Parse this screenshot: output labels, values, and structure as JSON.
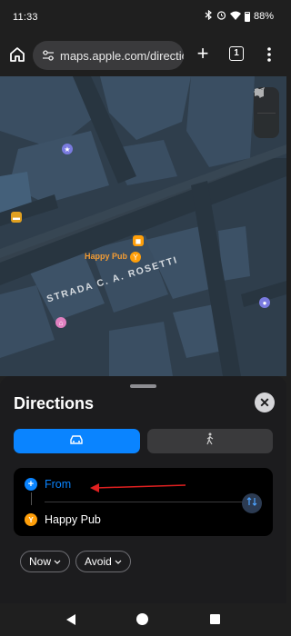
{
  "status_bar": {
    "time": "11:33",
    "battery": "88%",
    "icons": [
      "bluetooth-icon",
      "alarm-icon",
      "wifi-icon",
      "battery-icon"
    ]
  },
  "browser": {
    "url": "maps.apple.com/directio",
    "tab_count": "1",
    "icons": [
      "home-icon",
      "site-settings-icon",
      "new-tab-icon",
      "tabs-icon",
      "menu-icon"
    ]
  },
  "map": {
    "street_name": "STRADA C. A. ROSETTI",
    "poi_name": "Happy Pub",
    "controls": [
      "map-mode-icon",
      "locate-icon"
    ]
  },
  "directions": {
    "title": "Directions",
    "modes": [
      {
        "name": "drive",
        "icon": "car-icon",
        "active": true
      },
      {
        "name": "walk",
        "icon": "walk-icon",
        "active": false
      }
    ],
    "from_label": "From",
    "to_label": "Happy Pub",
    "options": [
      "Now",
      "Avoid"
    ]
  },
  "colors": {
    "accent": "#0a84ff",
    "poi": "#ff9f0a",
    "annotation": "#e02020"
  }
}
